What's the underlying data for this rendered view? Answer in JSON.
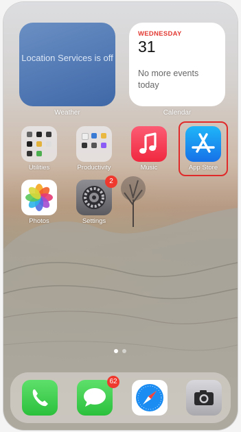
{
  "widgets": {
    "weather": {
      "message": "Location Services is off",
      "label": "Weather"
    },
    "calendar": {
      "weekday": "WEDNESDAY",
      "date": "31",
      "events": "No more events today",
      "label": "Calendar"
    }
  },
  "apps": [
    {
      "label": "Utilities",
      "icon": "folder-icon"
    },
    {
      "label": "Productivity",
      "icon": "folder-icon"
    },
    {
      "label": "Music",
      "icon": "music-note-icon"
    },
    {
      "label": "App Store",
      "icon": "app-store-icon",
      "highlighted": true
    },
    {
      "label": "Photos",
      "icon": "photos-flower-icon"
    },
    {
      "label": "Settings",
      "icon": "gear-icon",
      "badge": "2"
    }
  ],
  "dock": [
    {
      "icon": "phone-icon"
    },
    {
      "icon": "messages-icon",
      "badge": "62"
    },
    {
      "icon": "safari-compass-icon"
    },
    {
      "icon": "camera-icon"
    }
  ],
  "page_indicator": {
    "pages": 2,
    "current": 1
  },
  "colors": {
    "highlight": "#e02a2a",
    "badge": "#f0392e",
    "calendar_accent": "#e23a33"
  }
}
